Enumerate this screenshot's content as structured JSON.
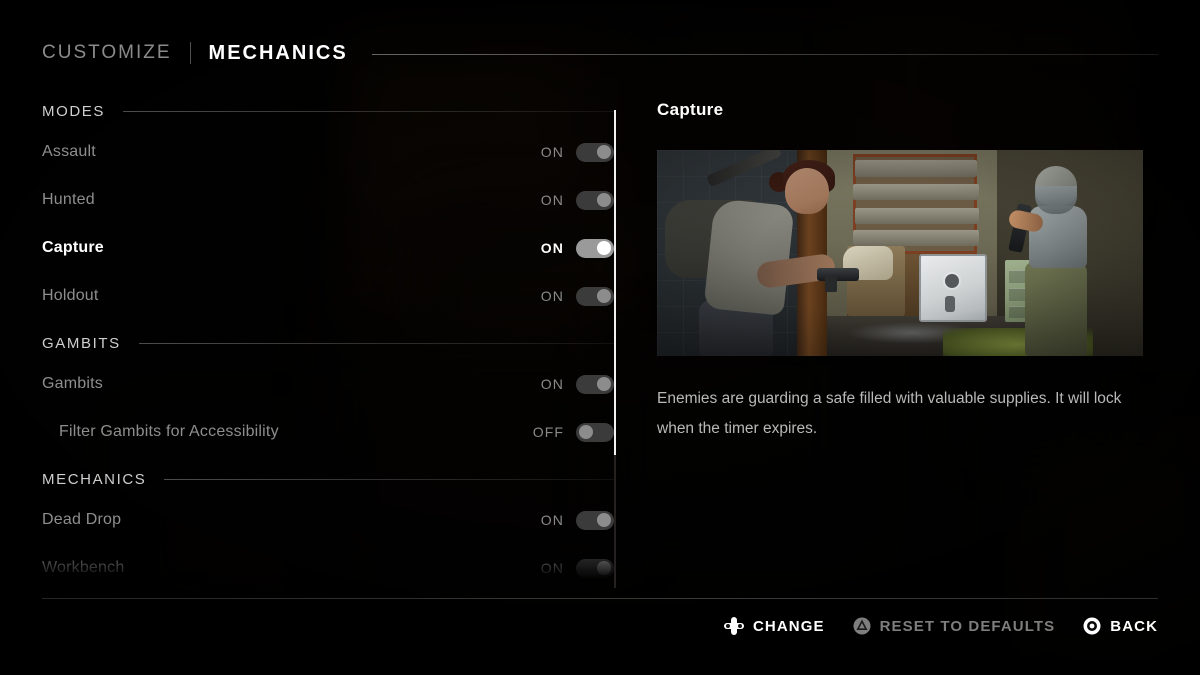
{
  "header": {
    "breadcrumb_parent": "CUSTOMIZE",
    "breadcrumb_current": "MECHANICS"
  },
  "sections": [
    {
      "title": "MODES",
      "rows": [
        {
          "label": "Assault",
          "state": "ON",
          "toggle": "on",
          "selected": false,
          "indent": false
        },
        {
          "label": "Hunted",
          "state": "ON",
          "toggle": "on",
          "selected": false,
          "indent": false
        },
        {
          "label": "Capture",
          "state": "ON",
          "toggle": "on",
          "selected": true,
          "indent": false
        },
        {
          "label": "Holdout",
          "state": "ON",
          "toggle": "on",
          "selected": false,
          "indent": false
        }
      ]
    },
    {
      "title": "GAMBITS",
      "rows": [
        {
          "label": "Gambits",
          "state": "ON",
          "toggle": "on",
          "selected": false,
          "indent": false
        },
        {
          "label": "Filter Gambits for Accessibility",
          "state": "OFF",
          "toggle": "off",
          "selected": false,
          "indent": true
        }
      ]
    },
    {
      "title": "MECHANICS",
      "rows": [
        {
          "label": "Dead Drop",
          "state": "ON",
          "toggle": "on",
          "selected": false,
          "indent": false
        },
        {
          "label": "Workbench",
          "state": "ON",
          "toggle": "on",
          "selected": false,
          "indent": false
        }
      ]
    }
  ],
  "detail": {
    "title": "Capture",
    "description": "Enemies are guarding a safe filled with valuable supplies. It will lock when the timer expires.",
    "preview_alt": "capture-mode-screenshot"
  },
  "footer": {
    "buttons": [
      {
        "icon": "dpad-icon",
        "label": "CHANGE",
        "dim": false
      },
      {
        "icon": "triangle-icon",
        "label": "RESET TO DEFAULTS",
        "dim": true
      },
      {
        "icon": "circle-icon",
        "label": "BACK",
        "dim": false
      }
    ]
  },
  "colors": {
    "accent_white": "#ffffff",
    "label_dim": "#8e8e8e",
    "toggle_track_off": "#3b3b3b",
    "toggle_track_on": "#9a9a9a",
    "background": "#050403"
  }
}
